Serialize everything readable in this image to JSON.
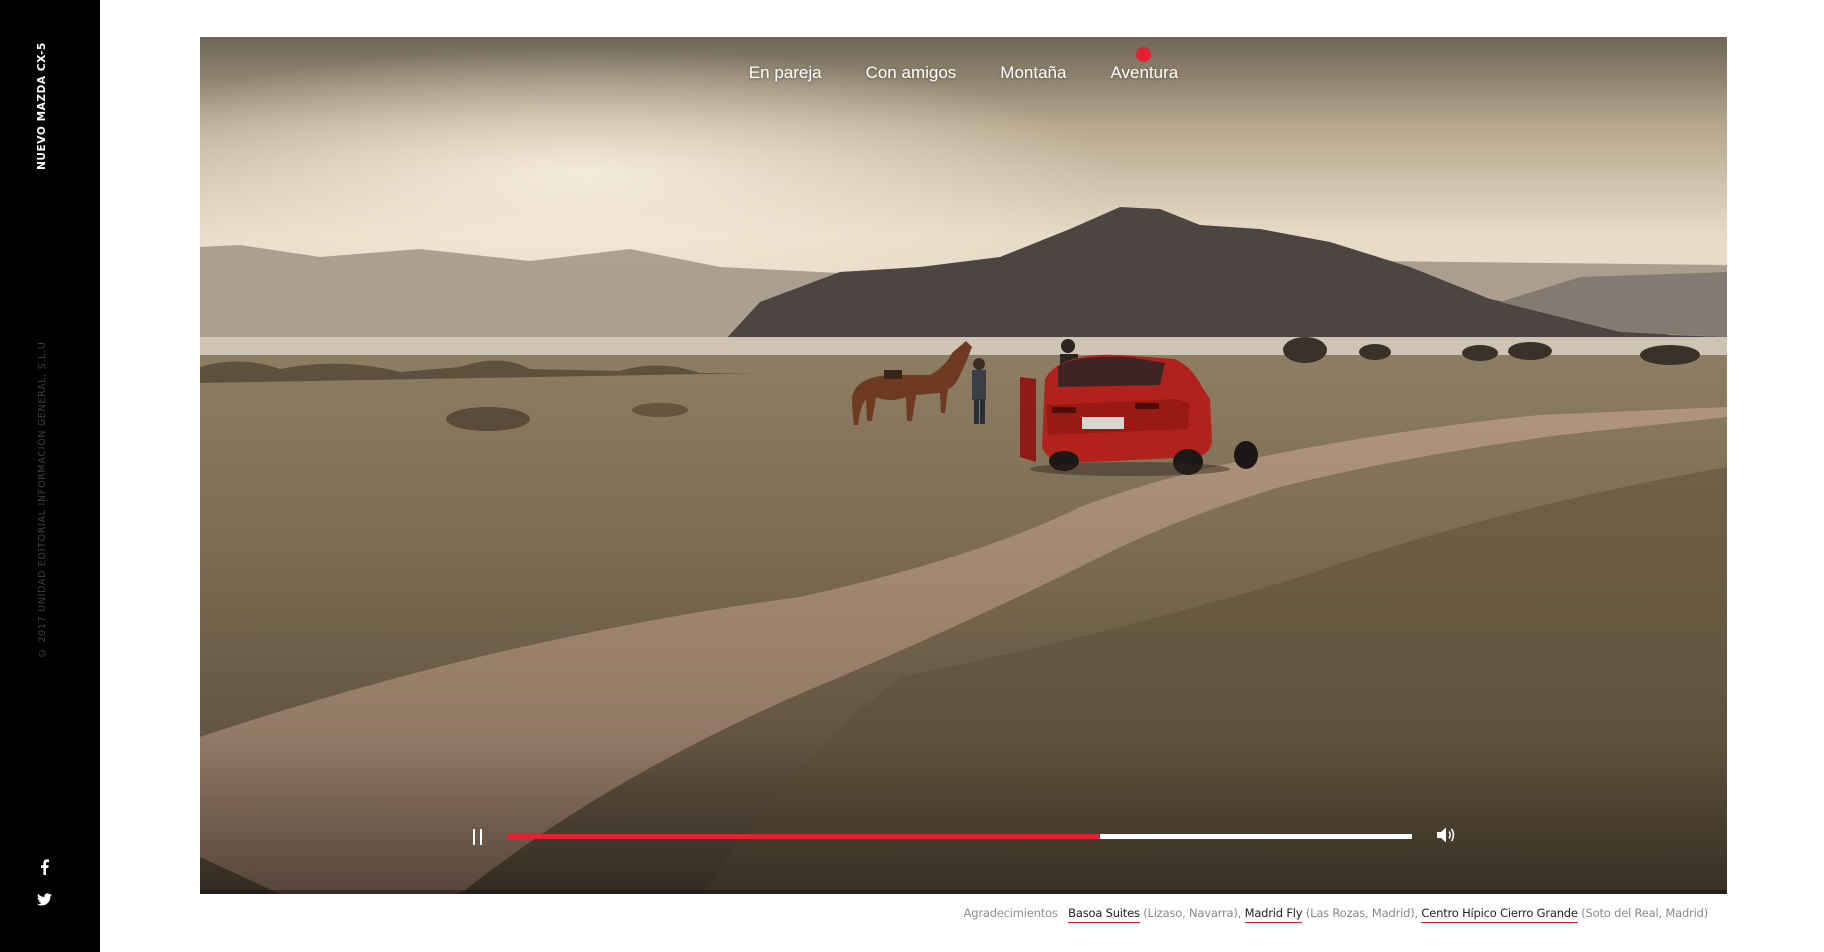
{
  "sidebar": {
    "brand": "NUEVO MAZDA CX-5",
    "copyright": "© 2017 UNIDAD EDITORIAL INFORMACIÓN GENERAL, S.L.U",
    "social": [
      {
        "icon": "facebook-icon"
      },
      {
        "icon": "twitter-icon"
      }
    ]
  },
  "video": {
    "tabs": [
      {
        "label": "En pareja",
        "active": false
      },
      {
        "label": "Con amigos",
        "active": false
      },
      {
        "label": "Montaña",
        "active": false
      },
      {
        "label": "Aventura",
        "active": true
      }
    ],
    "controls": {
      "play_state": "pause-icon",
      "volume_icon": "volume-icon",
      "progress": 0.655
    }
  },
  "credits": {
    "lead": "Agradecimientos",
    "items": [
      {
        "name": "Basoa Suites",
        "location": "(Lizaso, Navarra)",
        "sep": ", "
      },
      {
        "name": "Madrid Fly",
        "location": "(Las Rozas, Madrid)",
        "sep": ", "
      },
      {
        "name": "Centro Hípico Cierro Grande",
        "location": "(Soto del Real, Madrid)",
        "sep": ""
      }
    ]
  },
  "colors": {
    "accent": "#e5202e",
    "rail": "#000000",
    "track": "#ffffff"
  }
}
